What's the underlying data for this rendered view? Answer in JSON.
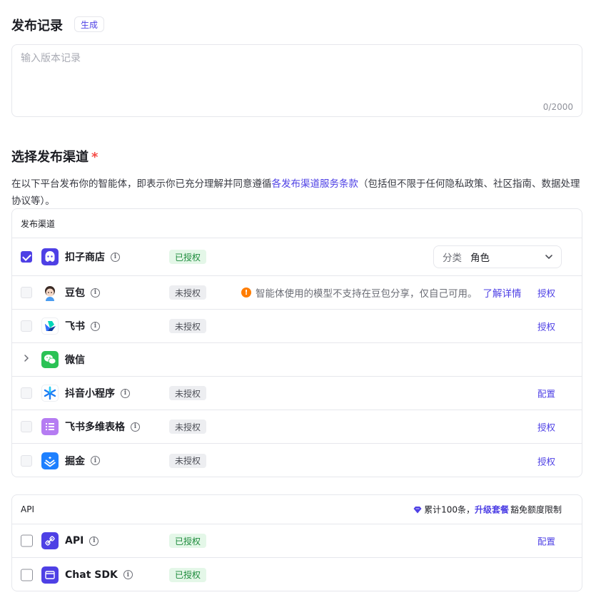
{
  "release": {
    "title": "发布记录",
    "generate_label": "生成",
    "placeholder": "输入版本记录",
    "counter": "0/2000"
  },
  "channels_section": {
    "title": "选择发布渠道",
    "required_mark": "*",
    "desc_before": "在以下平台发布你的智能体，即表示你已充分理解并同意遵循",
    "desc_link": "各发布渠道服务条款",
    "desc_after": "（包括但不限于任何隐私政策、社区指南、数据处理协议等）。"
  },
  "publish_card": {
    "header": "发布渠道",
    "rows": [
      {
        "name": "扣子商店",
        "status": "已授权",
        "category_label": "分类",
        "category_value": "角色",
        "icon": "coze-store-icon"
      },
      {
        "name": "豆包",
        "status": "未授权",
        "warning": "智能体使用的模型不支持在豆包分享，仅自己可用。",
        "warning_link": "了解详情",
        "action": "授权",
        "icon": "doubao-icon"
      },
      {
        "name": "飞书",
        "status": "未授权",
        "action": "授权",
        "icon": "feishu-icon"
      },
      {
        "name": "微信",
        "icon": "wechat-icon"
      },
      {
        "name": "抖音小程序",
        "status": "未授权",
        "action": "配置",
        "icon": "douyin-miniapp-icon"
      },
      {
        "name": "飞书多维表格",
        "status": "未授权",
        "action": "授权",
        "icon": "feishu-bitable-icon"
      },
      {
        "name": "掘金",
        "status": "未授权",
        "action": "授权",
        "icon": "juejin-icon"
      }
    ]
  },
  "api_card": {
    "header": "API",
    "quota_before": "累计100条，",
    "quota_link": "升级套餐",
    "quota_after": "豁免额度限制",
    "rows": [
      {
        "name": "API",
        "status": "已授权",
        "action": "配置",
        "icon": "api-icon"
      },
      {
        "name": "Chat SDK",
        "status": "已授权",
        "icon": "chat-sdk-icon"
      }
    ]
  },
  "colors": {
    "accent": "#4e40e5",
    "authorized_bg": "#e4f7e8",
    "authorized_text": "#1b8a3a",
    "warning": "#ff7d00"
  }
}
